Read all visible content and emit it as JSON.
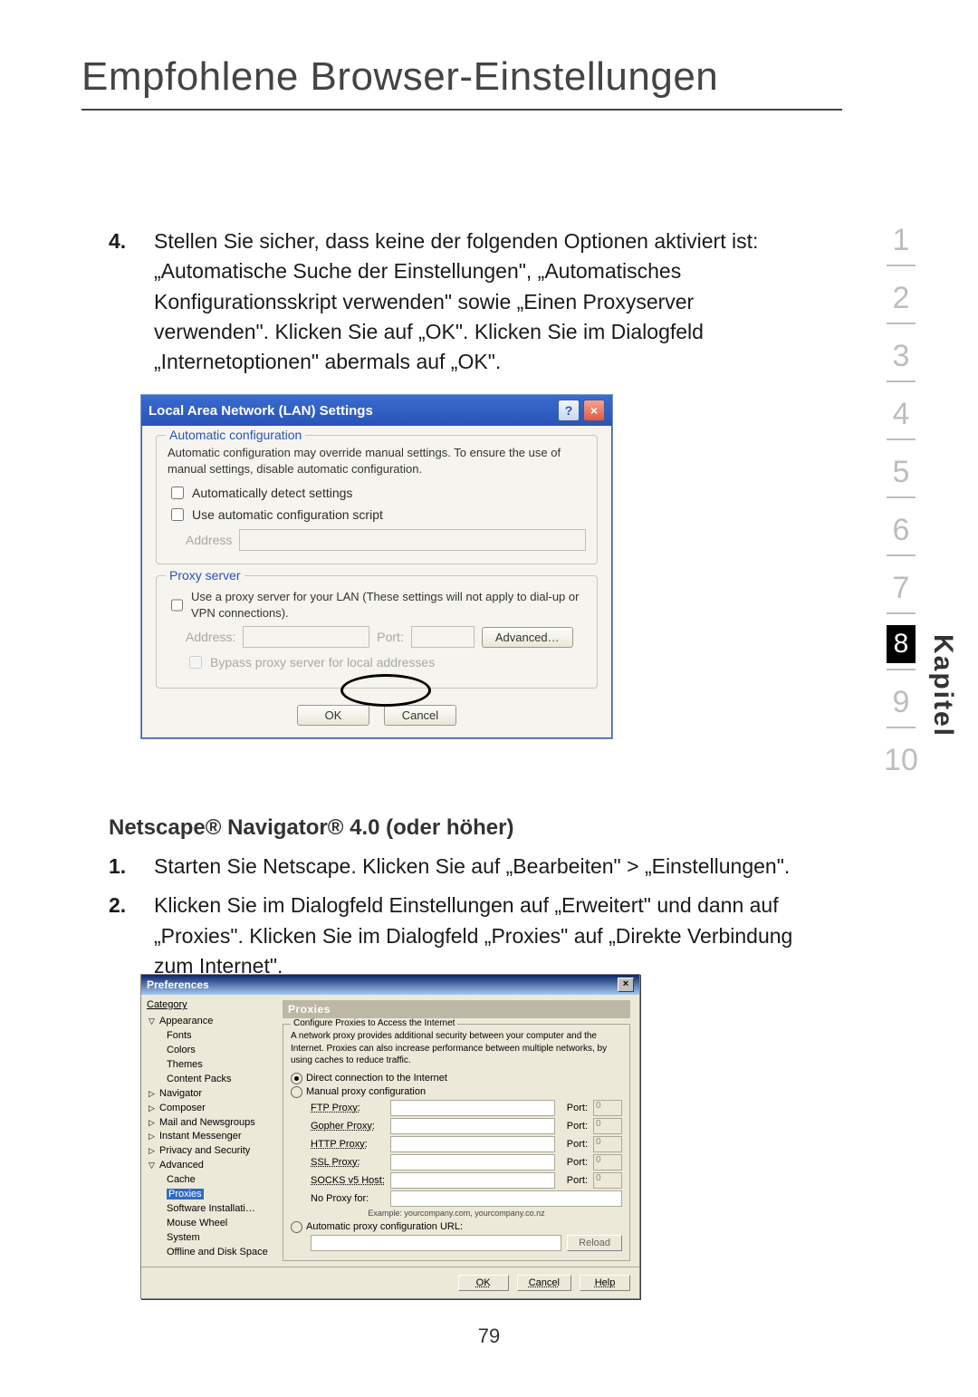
{
  "title": "Empfohlene Browser-Einstellungen",
  "side_label": "Kapitel",
  "side_nav": [
    "1",
    "2",
    "3",
    "4",
    "5",
    "6",
    "7",
    "8",
    "9",
    "10"
  ],
  "side_active_index": 7,
  "step4": {
    "n": "4.",
    "text": "Stellen Sie sicher, dass keine der folgenden Optionen aktiviert ist: „Automatische Suche der Einstellungen\", „Automatisches Konfigurationsskript verwenden\" sowie „Einen Proxyserver verwenden\". Klicken Sie auf „OK\". Klicken Sie im Dialogfeld „Internetoptionen\" abermals auf „OK\"."
  },
  "dlg1": {
    "title": "Local Area Network (LAN) Settings",
    "help": "?",
    "close": "×",
    "grp_auto_legend": "Automatic configuration",
    "grp_auto_desc": "Automatic configuration may override manual settings. To ensure the use of manual settings, disable automatic configuration.",
    "chk_auto": "Automatically detect settings",
    "chk_script": "Use automatic configuration script",
    "lbl_address1": "Address",
    "grp_proxy_legend": "Proxy server",
    "grp_proxy_desc": "Use a proxy server for your LAN (These settings will not apply to dial-up or VPN connections).",
    "lbl_address2": "Address:",
    "lbl_port": "Port:",
    "btn_adv": "Advanced…",
    "chk_bypass": "Bypass proxy server for local addresses",
    "ok": "OK",
    "cancel": "Cancel"
  },
  "netscape_heading": "Netscape® Navigator® 4.0 (oder höher)",
  "list2": [
    {
      "n": "1.",
      "t": "Starten Sie Netscape. Klicken Sie auf „Bearbeiten\" > „Einstellungen\"."
    },
    {
      "n": "2.",
      "t": "Klicken Sie im Dialogfeld Einstellungen auf „Erweitert\" und dann auf „Proxies\". Klicken Sie im Dialogfeld „Proxies\" auf „Direkte Verbindung zum Internet\"."
    }
  ],
  "dlg2": {
    "title": "Preferences",
    "close": "×",
    "cat_label": "Category",
    "tree": {
      "appearance": "Appearance",
      "appearance_children": [
        "Fonts",
        "Colors",
        "Themes",
        "Content Packs"
      ],
      "navigator": "Navigator",
      "composer": "Composer",
      "mail": "Mail and Newsgroups",
      "im": "Instant Messenger",
      "privacy": "Privacy and Security",
      "advanced": "Advanced",
      "advanced_children": [
        "Cache",
        "Proxies",
        "Software Installati…",
        "Mouse Wheel",
        "System",
        "Offline and Disk Space"
      ]
    },
    "panel_title": "Proxies",
    "grp_legend": "Configure Proxies to Access the Internet",
    "note": "A network proxy provides additional security between your computer and the Internet. Proxies can also increase performance between multiple networks, by using caches to reduce traffic.",
    "r_direct": "Direct connection to the Internet",
    "r_manual": "Manual proxy configuration",
    "rows": [
      {
        "l": "FTP Proxy:",
        "p": "Port:",
        "v": "0"
      },
      {
        "l": "Gopher Proxy:",
        "p": "Port:",
        "v": "0"
      },
      {
        "l": "HTTP Proxy:",
        "p": "Port:",
        "v": "0"
      },
      {
        "l": "SSL Proxy:",
        "p": "Port:",
        "v": "0"
      },
      {
        "l": "SOCKS v5 Host:",
        "p": "Port:",
        "v": "0"
      }
    ],
    "noproxy": "No Proxy for:",
    "example": "Example: yourcompany.com, yourcompany.co.nz",
    "r_auto": "Automatic proxy configuration URL:",
    "reload": "Reload",
    "ok": "OK",
    "cancel": "Cancel",
    "help": "Help"
  },
  "page_number": "79"
}
